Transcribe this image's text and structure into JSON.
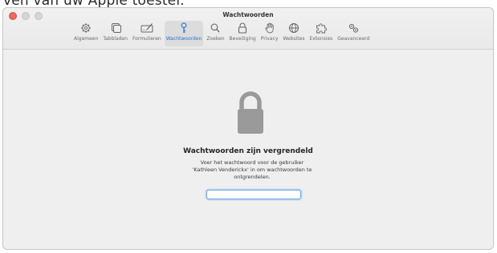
{
  "overlay": {
    "caption_fragment": "ven van uw Apple toestel."
  },
  "window": {
    "title": "Wachtwoorden"
  },
  "toolbar": {
    "tabs": [
      {
        "label": "Algemeen",
        "icon": "gear-icon"
      },
      {
        "label": "Tabbladen",
        "icon": "tabs-icon"
      },
      {
        "label": "Formulieren",
        "icon": "form-pencil-icon"
      },
      {
        "label": "Wachtwoorden",
        "icon": "key-icon",
        "active": true
      },
      {
        "label": "Zoeken",
        "icon": "magnifier-icon"
      },
      {
        "label": "Beveiliging",
        "icon": "lock-icon"
      },
      {
        "label": "Privacy",
        "icon": "hand-icon"
      },
      {
        "label": "Websites",
        "icon": "globe-icon"
      },
      {
        "label": "Extensies",
        "icon": "puzzle-icon"
      },
      {
        "label": "Geavanceerd",
        "icon": "gears-icon"
      }
    ],
    "accent_color": "#1f73d9"
  },
  "locked": {
    "icon": "padlock-icon",
    "title": "Wachtwoorden zijn vergrendeld",
    "desc_line1": "Voer het wachtwoord voor de gebruiker",
    "desc_line2": "'Kathleen Venderickx' in om wachtwoorden te",
    "desc_line3": "ontgrendelen.",
    "password_value": ""
  }
}
